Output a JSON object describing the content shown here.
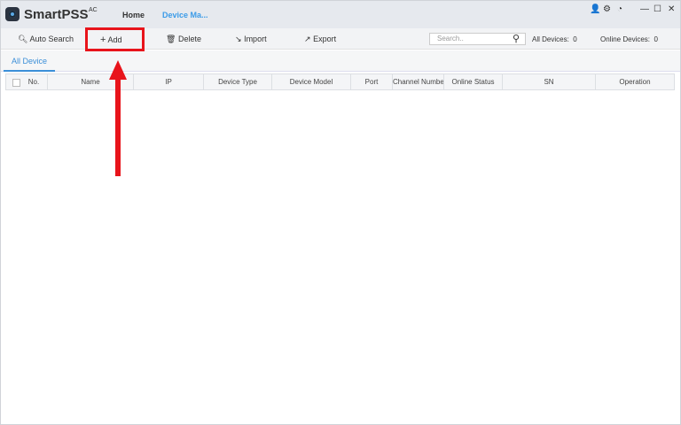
{
  "app": {
    "brand": "SmartPSS",
    "brand_sup": "AC"
  },
  "nav": {
    "home": "Home",
    "device_manager": "Device Ma..."
  },
  "window_controls": {
    "user": "👤",
    "settings": "⚙",
    "performance": "◔",
    "minimize": "—",
    "maximize": "☐",
    "close": "✕"
  },
  "toolbar": {
    "auto_search": "Auto Search",
    "add": "Add",
    "delete": "Delete",
    "import": "Import",
    "export": "Export",
    "search_placeholder": "Search..",
    "all_devices_label": "All Devices:",
    "all_devices_count": "0",
    "online_devices_label": "Online Devices:",
    "online_devices_count": "0"
  },
  "tabs": [
    {
      "label": "All Device",
      "active": true
    }
  ],
  "table": {
    "columns": [
      "No.",
      "Name",
      "IP",
      "Device Type",
      "Device Model",
      "Port",
      "Channel Number",
      "Online Status",
      "SN",
      "Operation"
    ],
    "rows": []
  },
  "annotation": {
    "color": "#e8141b"
  }
}
